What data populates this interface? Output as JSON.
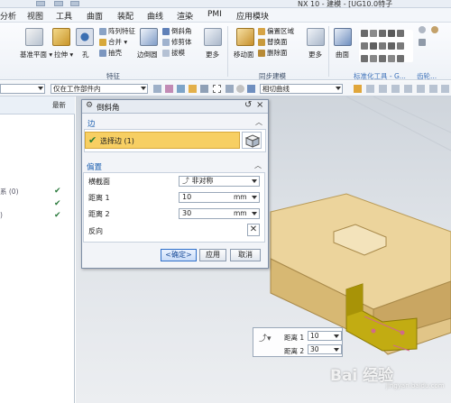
{
  "window": {
    "title": "NX 10 - 建模 - [UG10.0特子"
  },
  "menu": [
    "分析",
    "视图",
    "工具",
    "曲面",
    "装配",
    "曲线",
    "渲染",
    "PMI",
    "应用模块"
  ],
  "ribbon": {
    "big_tools": [
      {
        "label": "基准平面 ▾",
        "icon": "datum-plane-icon"
      },
      {
        "label": "拉伸 ▾",
        "icon": "extrude-icon"
      },
      {
        "label": "孔",
        "icon": "hole-icon"
      },
      {
        "label": "边倒圆",
        "icon": "edge-blend-icon"
      },
      {
        "label": "更多",
        "icon": "more-icon"
      },
      {
        "label": "移动面",
        "icon": "move-face-icon"
      },
      {
        "label": "更多",
        "icon": "more-icon"
      },
      {
        "label": "曲面",
        "icon": "surface-icon"
      }
    ],
    "small_tools": [
      "阵列特征",
      "合并 ▾",
      "抽壳",
      "倒斜角",
      "修剪体",
      "拔模",
      "偏置区域",
      "替换面",
      "删除面"
    ],
    "groups": [
      "特征",
      "同步建模",
      "标准化工具 - G...",
      "齿轮..."
    ]
  },
  "selection_bar": {
    "filter_value": "",
    "scope_value": "仅在工作部件内",
    "curve_rule_value": "相切曲线"
  },
  "navigator": {
    "column_header": "最新",
    "rows": [
      {
        "text": "",
        "checked": false
      },
      {
        "text": "",
        "checked": false
      },
      {
        "text": "",
        "checked": false
      },
      {
        "text": "系 (0)",
        "checked": true
      },
      {
        "text": "",
        "checked": true
      },
      {
        "text": ")",
        "checked": true
      }
    ]
  },
  "dialog": {
    "title": "倒斜角",
    "edge_section": "边",
    "select_edge": "选择边 (1)",
    "offset_section": "偏置",
    "cross_section_label": "横截面",
    "cross_section_value": "非对称",
    "distance1_label": "距离 1",
    "distance1_value": "10",
    "distance1_unit": "mm",
    "distance2_label": "距离 2",
    "distance2_value": "30",
    "distance2_unit": "mm",
    "reverse_label": "反向",
    "ok_label": "<确定>",
    "apply_label": "应用",
    "cancel_label": "取消"
  },
  "handle_box": {
    "distance1_label": "距离 1",
    "distance1_value": "10",
    "distance2_label": "距离 2",
    "distance2_value": "30"
  },
  "watermark": {
    "text": "Bai 经验",
    "sub": "jingyan.baidu.com"
  },
  "colors": {
    "accent": "#f7cf63",
    "part": "#ecd49c",
    "highlight": "#c2ac12",
    "section_title": "#1c5fb0"
  }
}
